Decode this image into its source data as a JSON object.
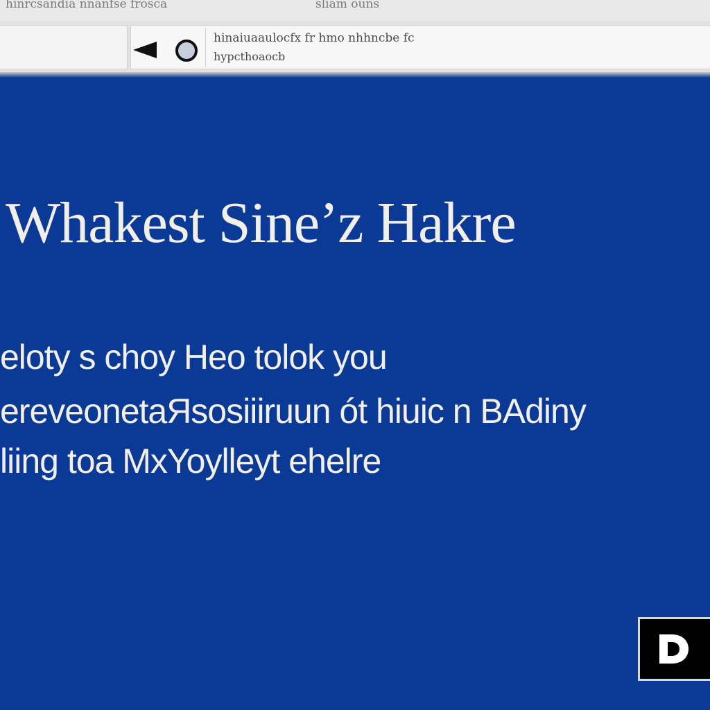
{
  "browser": {
    "tab_strip": {
      "tab_left_text": "hinrcsandia nnanfse frosca",
      "tab_right_text": "sliam ouns"
    },
    "toolbar": {
      "address_line1": "hinaiuaaulocfx fr hmo nhhncbe fc",
      "address_line2": "hypcthoaocb"
    }
  },
  "page": {
    "headline": "Whakest Sine’z Hakre",
    "body_lines": [
      "eloty s choy  Heo tolok you",
      "ereveonetaЯsosiiiruun  ót  hiuic  n  BAdiny",
      "liing toa MxYoylleyt  ehelre"
    ]
  },
  "colors": {
    "page_background": "#0b3a96",
    "text_color": "#f1efe8",
    "toolbar_background": "#e2e2e2",
    "badge_background": "#000000"
  },
  "icons": {
    "back": "back-arrow-icon",
    "reload": "reload-circle-icon",
    "badge": "letter-d-logo-icon"
  }
}
